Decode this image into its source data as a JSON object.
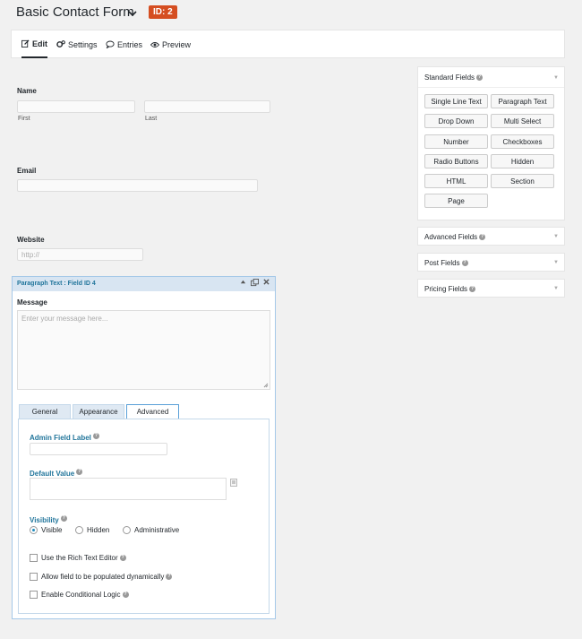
{
  "header": {
    "form_title": "Basic Contact Form",
    "id_badge": "ID: 2"
  },
  "toolbar": {
    "tabs": [
      {
        "label": "Edit",
        "icon": "edit-icon"
      },
      {
        "label": "Settings",
        "icon": "gears-icon"
      },
      {
        "label": "Entries",
        "icon": "comment-icon"
      },
      {
        "label": "Preview",
        "icon": "eye-icon"
      }
    ]
  },
  "form": {
    "name_label": "Name",
    "first_label": "First",
    "last_label": "Last",
    "email_label": "Email",
    "website_label": "Website",
    "website_placeholder": "http://"
  },
  "paragraph_field": {
    "header": "Paragraph Text : Field ID 4",
    "label": "Message",
    "placeholder": "Enter your message here...",
    "settings_tabs": [
      "General",
      "Appearance",
      "Advanced"
    ],
    "active_tab": "Advanced",
    "admin_field_label": "Admin Field Label",
    "default_value_label": "Default Value",
    "visibility_label": "Visibility",
    "visibility_options": [
      "Visible",
      "Hidden",
      "Administrative"
    ],
    "visibility_selected": "Visible",
    "checkboxes": [
      "Use the Rich Text Editor",
      "Allow field to be populated dynamically",
      "Enable Conditional Logic"
    ]
  },
  "sidebar": {
    "standard_title": "Standard Fields",
    "standard_buttons": [
      "Single Line Text",
      "Paragraph Text",
      "Drop Down",
      "Multi Select",
      "Number",
      "Checkboxes",
      "Radio Buttons",
      "Hidden",
      "HTML",
      "Section",
      "Page"
    ],
    "advanced_title": "Advanced Fields",
    "post_title": "Post Fields",
    "pricing_title": "Pricing Fields"
  },
  "colors": {
    "badge": "#d54e21",
    "link_blue": "#21759b",
    "field_header": "#d8e5f2"
  }
}
